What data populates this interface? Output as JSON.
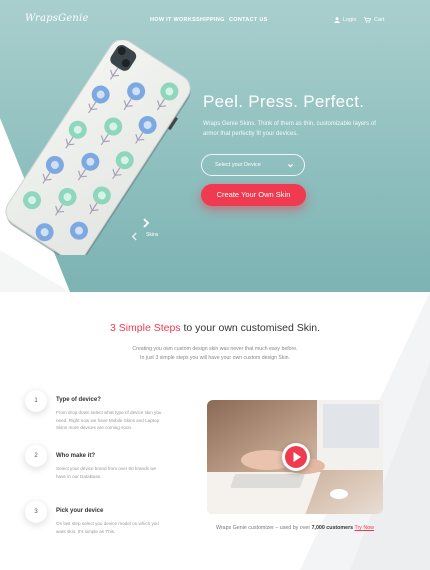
{
  "brand": {
    "logo": "WrapsGenie"
  },
  "nav": {
    "links": [
      "HOW IT WORKS",
      "SHIPPING",
      "CONTACT US"
    ],
    "login": "Login",
    "cart": "Cart"
  },
  "hero": {
    "headline": "Peel. Press. Perfect.",
    "subtext": "Wraps Genie Skins. Think of them as thin, customizable layers of armor that perfectly fit your devices.",
    "select_placeholder": "Select your Device",
    "cta": "Create Your Own Skin",
    "carousel_label": "Skins"
  },
  "steps": {
    "title_accent": "3 Simple Steps",
    "title_rest": " to your own customised Skin.",
    "desc_line1": "Creating you own custom design skin was never that much easy before.",
    "desc_line2": "In just 3 simple steps you will have your own custom design Skin.",
    "items": [
      {
        "num": "1",
        "title": "Type of device?",
        "text": "From drop down select what type of device skin you need. Right now we have Mobile Skins and Laptop Skins more devices are coming soon."
      },
      {
        "num": "2",
        "title": "Who make it?",
        "text": "Select your device brand from over 80 brands we have in our DataBase."
      },
      {
        "num": "3",
        "title": "Pick your device",
        "text": "On last step select you device model on which you want skin. It's simple as This."
      }
    ]
  },
  "video": {
    "caption_pre": "Wraps Genie customizer – used by over ",
    "caption_bold": "7,000 customers",
    "caption_link": "Try Now"
  },
  "colors": {
    "accent": "#ef3a4f",
    "teal": "#8fc0bf"
  }
}
